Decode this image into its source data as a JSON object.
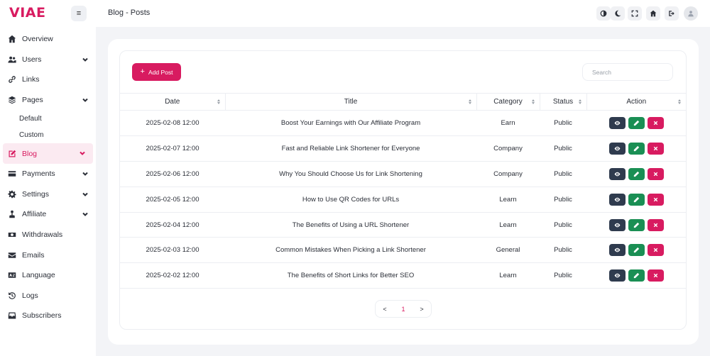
{
  "brand": "VIAE",
  "header": {
    "title": "Blog - Posts"
  },
  "sidebar": {
    "items": [
      {
        "label": "Overview",
        "icon": "home-icon",
        "chevron": false
      },
      {
        "label": "Users",
        "icon": "users-icon",
        "chevron": true
      },
      {
        "label": "Links",
        "icon": "link-icon",
        "chevron": false
      },
      {
        "label": "Pages",
        "icon": "layers-icon",
        "chevron": true,
        "children": [
          "Default",
          "Custom"
        ]
      },
      {
        "label": "Blog",
        "icon": "pencil-icon",
        "chevron": true,
        "active": true
      },
      {
        "label": "Payments",
        "icon": "credit-card-icon",
        "chevron": true
      },
      {
        "label": "Settings",
        "icon": "gear-icon",
        "chevron": true
      },
      {
        "label": "Affiliate",
        "icon": "sitemap-icon",
        "chevron": true
      },
      {
        "label": "Withdrawals",
        "icon": "money-icon",
        "chevron": false
      },
      {
        "label": "Emails",
        "icon": "envelope-icon",
        "chevron": false
      },
      {
        "label": "Language",
        "icon": "language-icon",
        "chevron": false
      },
      {
        "label": "Logs",
        "icon": "history-icon",
        "chevron": false
      },
      {
        "label": "Subscribers",
        "icon": "inbox-icon",
        "chevron": false
      }
    ]
  },
  "toolbar": {
    "add_label": "Add Post",
    "search_placeholder": "Search"
  },
  "table": {
    "columns": [
      "Date",
      "Title",
      "Category",
      "Status",
      "Action"
    ],
    "rows": [
      {
        "date": "2025-02-08 12:00",
        "title": "Boost Your Earnings with Our Affiliate Program",
        "category": "Earn",
        "status": "Public"
      },
      {
        "date": "2025-02-07 12:00",
        "title": "Fast and Reliable Link Shortener for Everyone",
        "category": "Company",
        "status": "Public"
      },
      {
        "date": "2025-02-06 12:00",
        "title": "Why You Should Choose Us for Link Shortening",
        "category": "Company",
        "status": "Public"
      },
      {
        "date": "2025-02-05 12:00",
        "title": "How to Use QR Codes for URLs",
        "category": "Learn",
        "status": "Public"
      },
      {
        "date": "2025-02-04 12:00",
        "title": "The Benefits of Using a URL Shortener",
        "category": "Learn",
        "status": "Public"
      },
      {
        "date": "2025-02-03 12:00",
        "title": "Common Mistakes When Picking a Link Shortener",
        "category": "General",
        "status": "Public"
      },
      {
        "date": "2025-02-02 12:00",
        "title": "The Benefits of Short Links for Better SEO",
        "category": "Learn",
        "status": "Public"
      }
    ]
  },
  "pagination": {
    "prev": "<",
    "current": "1",
    "next": ">"
  },
  "colors": {
    "brand": "#d81b60",
    "view": "#2f3b4e",
    "edit": "#1a8f54",
    "delete": "#d81b60"
  }
}
